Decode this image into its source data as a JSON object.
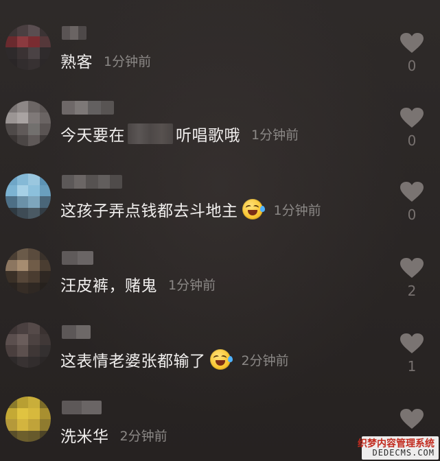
{
  "comments": [
    {
      "text": "熟客",
      "time": "1分钟前",
      "likes": "0",
      "avatar_colors": [
        "#3c3435",
        "#4a3f41",
        "#5a4e51",
        "#3b3334",
        "#6a2a2e",
        "#8b3a3f",
        "#7a2c31",
        "#55383a",
        "#2e2a2b",
        "#3a3233",
        "#4a4244",
        "#2f2b2c",
        "#2a2627",
        "#322d2e",
        "#373132",
        "#2c2829"
      ],
      "username_colors": [
        "#5a5454",
        "#6a6463",
        "#4e4949"
      ]
    },
    {
      "text_before": "今天要在",
      "text_after": "听唱歌哦",
      "time": "1分钟前",
      "likes": "0",
      "avatar_colors": [
        "#7a7474",
        "#8d8786",
        "#6c6665",
        "#5e5857",
        "#9b9594",
        "#a9a3a2",
        "#7f7978",
        "#6a6463",
        "#4f4a49",
        "#605a59",
        "#72706e",
        "#5a5453",
        "#3a3534",
        "#4b4645",
        "#5f5958",
        "#3f3a39"
      ],
      "username_colors": [
        "#6e6868",
        "#7d7877",
        "#636060",
        "#585453"
      ]
    },
    {
      "text": "这孩子弄点钱都去斗地主",
      "time": "1分钟前",
      "likes": "0",
      "avatar_colors": [
        "#6fa6c7",
        "#85b9d6",
        "#9ac7df",
        "#5d93b4",
        "#7cb3d2",
        "#a6d0e6",
        "#8cc0dc",
        "#6a9fbe",
        "#4d6f86",
        "#6b91a8",
        "#7ea6bd",
        "#4a6679",
        "#2f3a42",
        "#3e4b55",
        "#4a5963",
        "#333d45"
      ],
      "username_colors": [
        "#5c5858",
        "#6b6665",
        "#565251",
        "#625e5d",
        "#4f4b4a"
      ]
    },
    {
      "text": "汪皮裤，赌鬼",
      "time": "1分钟前",
      "likes": "2",
      "avatar_colors": [
        "#4b3f34",
        "#6a5a49",
        "#5a4b3d",
        "#3a322b",
        "#8c7660",
        "#a68c70",
        "#705c48",
        "#4a3d31",
        "#3a3027",
        "#574739",
        "#4a3c30",
        "#2e2722",
        "#2a2420",
        "#362d26",
        "#2f2823",
        "#26211d"
      ],
      "username_colors": [
        "#5f5a5a",
        "#6a6565"
      ]
    },
    {
      "text": "这表情老婆张都输了",
      "time": "2分钟前",
      "likes": "1",
      "avatar_colors": [
        "#3f3636",
        "#4a4040",
        "#554a49",
        "#3a3231",
        "#5b4f4e",
        "#6a5d5b",
        "#4c4241",
        "#403837",
        "#4a3f3e",
        "#5c504e",
        "#3f3736",
        "#343030",
        "#2e2a2a",
        "#383232",
        "#322d2d",
        "#2b2727"
      ],
      "username_colors": [
        "#5c5757",
        "#6d6867"
      ]
    },
    {
      "text": "洗米华",
      "time": "2分钟前",
      "likes": "",
      "avatar_colors": [
        "#8a7a2c",
        "#b89f32",
        "#c9ae3a",
        "#7c6c28",
        "#c4a935",
        "#e0c341",
        "#d7b93d",
        "#a88f30",
        "#b5993a",
        "#d3b43f",
        "#c0a33a",
        "#8f7b2f",
        "#5a4f2a",
        "#6d5f2d",
        "#675a2c",
        "#4e4527"
      ],
      "username_colors": [
        "#5d5858",
        "#6a6565"
      ]
    }
  ],
  "watermark": {
    "line1": "织梦内容管理系统",
    "line2": "DEDECMS.COM"
  }
}
